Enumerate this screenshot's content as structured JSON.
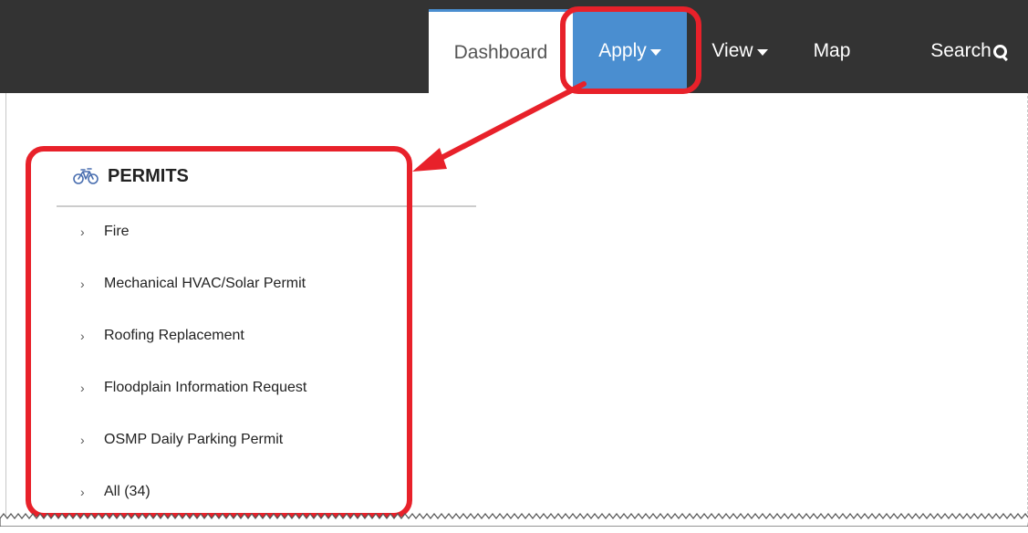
{
  "nav": {
    "dashboard": "Dashboard",
    "apply": "Apply",
    "view": "View",
    "map": "Map",
    "search": "Search"
  },
  "permits": {
    "title": "PERMITS",
    "icon": "bicycle-icon",
    "items": [
      {
        "label": "Fire"
      },
      {
        "label": "Mechanical HVAC/Solar Permit"
      },
      {
        "label": "Roofing Replacement"
      },
      {
        "label": "Floodplain Information Request"
      },
      {
        "label": "OSMP Daily Parking Permit"
      },
      {
        "label": "All (34)"
      }
    ]
  },
  "colors": {
    "navbar": "#333333",
    "active_tab": "#4a8ed0",
    "annotation": "#e8212a"
  }
}
